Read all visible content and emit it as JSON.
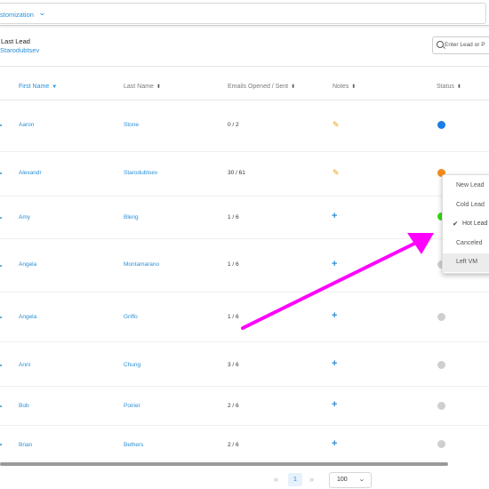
{
  "topbar": {
    "menu_label": "stomization"
  },
  "panel": {
    "last_lead_title": "Last Lead",
    "last_lead_name": "Starodubtsev",
    "search_placeholder": "Enter Lead or P"
  },
  "columns": {
    "first_name": "First Name",
    "last_name": "Last Name",
    "emails": "Emails Opened / Sent",
    "notes": "Notes",
    "status": "Status"
  },
  "rows": [
    {
      "first": "Aaron",
      "last": "Stone",
      "emails": "0 / 2",
      "note": "edit",
      "status_color": "#1a7ee8"
    },
    {
      "first": "Alexandr",
      "last": "Starodubtsev",
      "emails": "30 / 61",
      "note": "edit",
      "status_color": "#f28a1c"
    },
    {
      "first": "Amy",
      "last": "Blerig",
      "emails": "1 / 6",
      "note": "add",
      "status_color": "#33dd11"
    },
    {
      "first": "Angela",
      "last": "Montamarano",
      "emails": "1 / 6",
      "note": "add",
      "status_color": "#cfcfcf"
    },
    {
      "first": "Angela",
      "last": "Griffo",
      "emails": "1 / 6",
      "note": "add",
      "status_color": "#cfcfcf"
    },
    {
      "first": "Anni",
      "last": "Chung",
      "emails": "3 / 6",
      "note": "add",
      "status_color": "#cfcfcf"
    },
    {
      "first": "Bob",
      "last": "Poirier",
      "emails": "2 / 6",
      "note": "add",
      "status_color": "#cfcfcf"
    },
    {
      "first": "Brian",
      "last": "Bethers",
      "emails": "2 / 6",
      "note": "add",
      "status_color": "#cfcfcf"
    }
  ],
  "icons": {
    "note_edit": "edit-note-icon",
    "note_add": "add-note-icon",
    "search": "search-icon",
    "sort": "sort-icon"
  },
  "status_menu": {
    "items": [
      "New Lead",
      "Cold Lead",
      "Hot Lead",
      "Canceled",
      "Left VM"
    ],
    "checked": "Hot Lead",
    "highlighted": "Left VM"
  },
  "pagination": {
    "prev": "«",
    "page": "1",
    "next": "»",
    "page_size": "100"
  },
  "accent_color": "#2b8fd6",
  "annotation_color": "#ff00ff"
}
